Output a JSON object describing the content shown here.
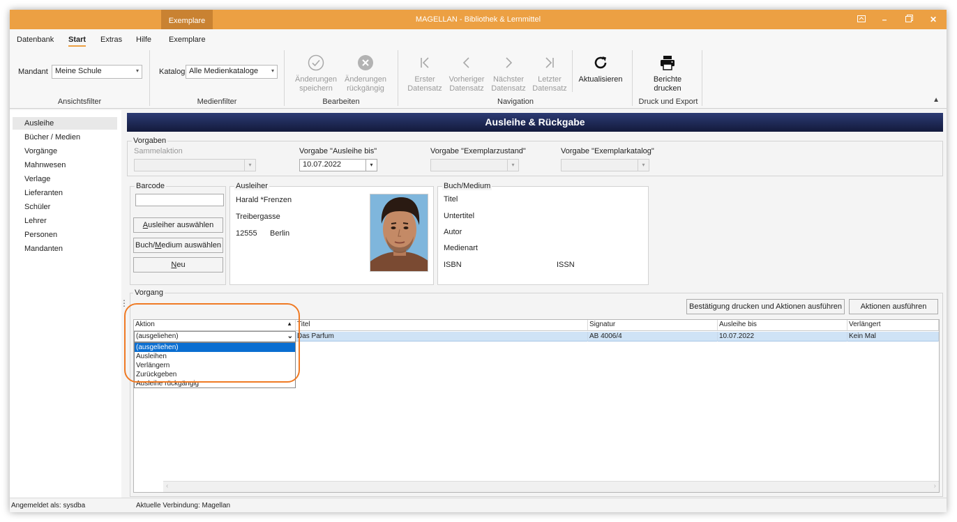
{
  "titlebar": {
    "context_tab": "Exemplare",
    "title": "MAGELLAN - Bibliothek & Lernmittel"
  },
  "menu": {
    "items": [
      "Datenbank",
      "Start",
      "Extras",
      "Hilfe",
      "Exemplare"
    ]
  },
  "ribbon": {
    "ansichtsfilter": {
      "mandant_label": "Mandant",
      "mandant_value": "Meine Schule",
      "group_label": "Ansichtsfilter"
    },
    "medienfilter": {
      "katalog_label": "Katalog",
      "katalog_value": "Alle Medienkataloge",
      "group_label": "Medienfilter"
    },
    "bearbeiten": {
      "save_line1": "Änderungen",
      "save_line2": "speichern",
      "undo_line1": "Änderungen",
      "undo_line2": "rückgängig",
      "group_label": "Bearbeiten"
    },
    "navigation": {
      "first_line1": "Erster",
      "first_line2": "Datensatz",
      "prev_line1": "Vorheriger",
      "prev_line2": "Datensatz",
      "next_line1": "Nächster",
      "next_line2": "Datensatz",
      "last_line1": "Letzter",
      "last_line2": "Datensatz",
      "refresh": "Aktualisieren",
      "group_label": "Navigation"
    },
    "druck": {
      "print_line1": "Berichte",
      "print_line2": "drucken",
      "group_label": "Druck und Export"
    }
  },
  "sidebar": {
    "items": [
      "Ausleihe",
      "Bücher / Medien",
      "Vorgänge",
      "Mahnwesen",
      "Verlage",
      "Lieferanten",
      "Schüler",
      "Lehrer",
      "Personen",
      "Mandanten"
    ]
  },
  "main": {
    "header": "Ausleihe & Rückgabe",
    "vorgaben": {
      "title": "Vorgaben",
      "sammelaktion_label": "Sammelaktion",
      "ausleihe_bis_label": "Vorgabe \"Ausleihe bis\"",
      "ausleihe_bis_value": "10.07.2022",
      "zustand_label": "Vorgabe \"Exemplarzustand\"",
      "katalog_label": "Vorgabe \"Exemplarkatalog\""
    },
    "barcode": {
      "title": "Barcode",
      "btn_ausleiher_prefix": "",
      "btn_ausleiher_ul": "A",
      "btn_ausleiher_rest": "usleiher auswählen",
      "btn_buch_prefix": "Buch/",
      "btn_buch_ul": "M",
      "btn_buch_rest": "edium auswählen",
      "btn_neu_prefix": "",
      "btn_neu_ul": "N",
      "btn_neu_rest": "eu"
    },
    "ausleiher": {
      "title": "Ausleiher",
      "name": "Harald *Frenzen",
      "street": "Treibergasse",
      "zip": "12555",
      "city": "Berlin"
    },
    "medium": {
      "title": "Buch/Medium",
      "titel": "Titel",
      "untertitel": "Untertitel",
      "autor": "Autor",
      "medienart": "Medienart",
      "isbn": "ISBN",
      "issn": "ISSN"
    },
    "vorgang": {
      "title": "Vorgang",
      "btn_confirm": "Bestätigung drucken und Aktionen ausführen",
      "btn_actions": "Aktionen ausführen",
      "columns": [
        "Aktion",
        "Titel",
        "Signatur",
        "Ausleihe bis",
        "Verlängert"
      ],
      "row": {
        "aktion": "(ausgeliehen)",
        "titel": "Das Parfum",
        "signatur": "AB 4006/4",
        "ausleihe_bis": "10.07.2022",
        "verlaengert": "Kein Mal"
      },
      "dropdown_options": [
        "(ausgeliehen)",
        "Ausleihen",
        "Verlängern",
        "Zurückgeben",
        "Ausleihe rückgängig"
      ],
      "dropdown_selected": "(ausgeliehen)"
    }
  },
  "status": {
    "user": "Angemeldet als: sysdba",
    "connection": "Aktuelle Verbindung: Magellan"
  },
  "colors": {
    "titlebar": "#eca043",
    "context_tab": "#c98232",
    "header_bar": "#1f2a5a",
    "highlight": "#ef7a24",
    "selection": "#0a6ed1"
  }
}
